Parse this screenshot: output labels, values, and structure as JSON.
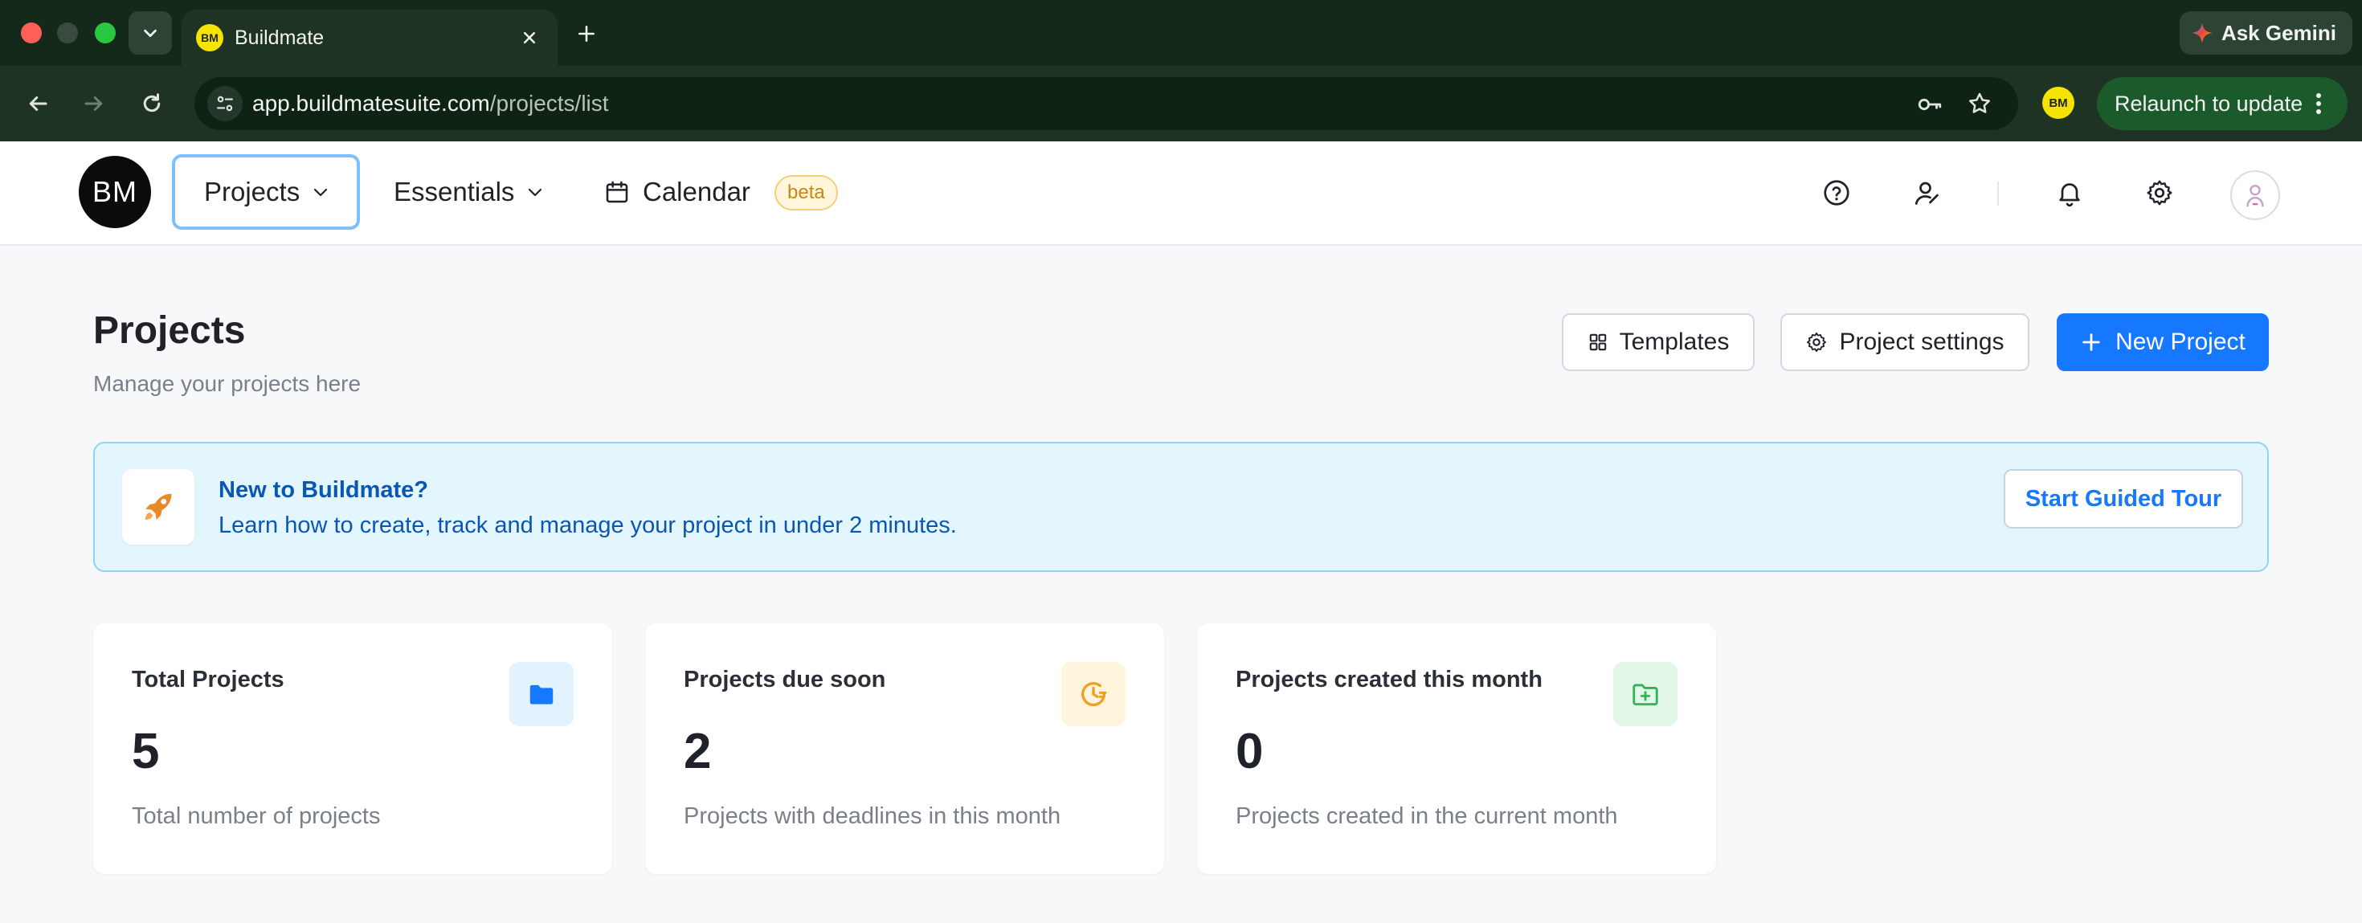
{
  "browser": {
    "tab_title": "Buildmate",
    "tab_favicon_text": "BM",
    "url_host": "app.buildmatesuite.com",
    "url_path": "/projects/list",
    "gemini_label": "Ask Gemini",
    "profile_text": "BM",
    "relaunch_label": "Relaunch to update"
  },
  "header": {
    "logo_text": "BM",
    "nav": {
      "projects": "Projects",
      "essentials": "Essentials",
      "calendar": "Calendar",
      "beta": "beta"
    }
  },
  "page": {
    "title": "Projects",
    "subtitle": "Manage your projects here",
    "buttons": {
      "templates": "Templates",
      "settings": "Project settings",
      "new_project": "New Project"
    }
  },
  "tour": {
    "title": "New to Buildmate?",
    "text": "Learn how to create, track and manage your project in under 2 minutes.",
    "button": "Start Guided Tour"
  },
  "cards": [
    {
      "label": "Total Projects",
      "value": "5",
      "desc": "Total number of projects",
      "icon": "folder-icon",
      "color": "#1677ff"
    },
    {
      "label": "Projects due soon",
      "value": "2",
      "desc": "Projects with deadlines in this month",
      "icon": "clock-icon",
      "color": "#f0a020"
    },
    {
      "label": "Projects created this month",
      "value": "0",
      "desc": "Projects created in the current month",
      "icon": "folder-plus-icon",
      "color": "#2fb45a"
    }
  ],
  "colors": {
    "primary": "#1677ff",
    "tour_bg": "#e4f6fd",
    "chrome_bg": "#14291a"
  }
}
